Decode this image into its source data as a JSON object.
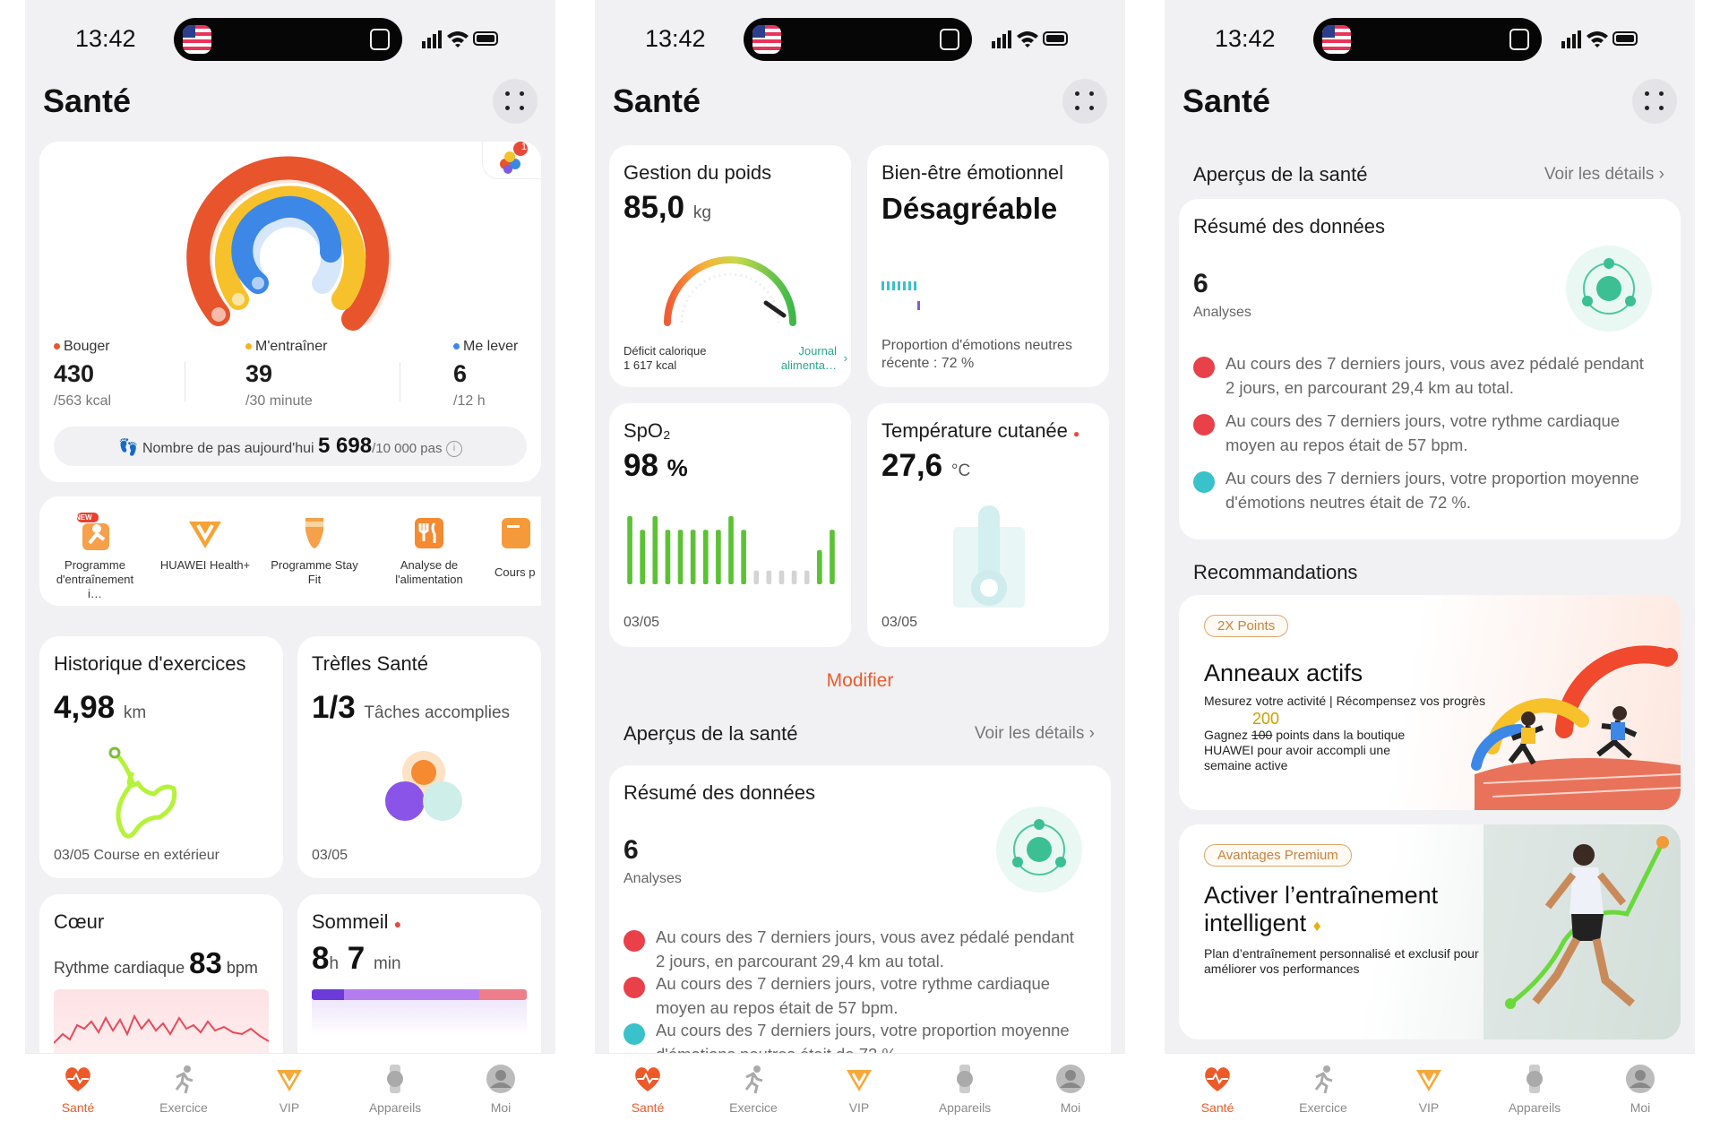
{
  "status": {
    "time": "13:42"
  },
  "app": {
    "title": "Santé"
  },
  "rings": {
    "move": {
      "label": "Bouger",
      "value": "430",
      "target": "/563 kcal",
      "color": "#e8412c"
    },
    "exercise": {
      "label": "M'entraîner",
      "value": "39",
      "target": "/30 minute",
      "color": "#f5b31c"
    },
    "stand": {
      "label": "Me lever",
      "value": "6",
      "target": "/12 h",
      "color": "#3a86e8"
    },
    "steps_label": "Nombre de pas aujourd'hui",
    "steps_value": "5 698",
    "steps_target": "/10 000 pas",
    "badge": "1"
  },
  "shortcuts": [
    {
      "label": "Programme d'entraînement i…",
      "icon": "training-plan-icon",
      "badge": "NEW"
    },
    {
      "label": "HUAWEI Health+",
      "icon": "health-plus-icon"
    },
    {
      "label": "Programme Stay Fit",
      "icon": "stay-fit-icon"
    },
    {
      "label": "Analyse de l'alimentation",
      "icon": "food-analysis-icon"
    },
    {
      "label": "Cours p",
      "icon": "courses-icon"
    }
  ],
  "exercise_history": {
    "title": "Historique d'exercices",
    "value": "4,98",
    "unit": "km",
    "date": "03/05 Course en extérieur"
  },
  "clovers": {
    "title": "Trèfles Santé",
    "value": "1/3",
    "unit": "Tâches accomplies",
    "date": "03/05"
  },
  "heart": {
    "title": "Cœur",
    "label": "Rythme cardiaque",
    "value": "83",
    "unit": "bpm"
  },
  "sleep": {
    "title": "Sommeil",
    "hours": "8",
    "h_unit": "h",
    "minutes": "7",
    "m_unit": "min"
  },
  "weight": {
    "title": "Gestion du poids",
    "value": "85,0",
    "unit": "kg",
    "deficit_label": "Déficit calorique",
    "deficit_value": "1 617 kcal",
    "journal": "Journal alimenta…"
  },
  "emotion": {
    "title": "Bien-être émotionnel",
    "value": "Désagréable",
    "caption": "Proportion d'émotions neutres récente : 72 %"
  },
  "spo2": {
    "title": "SpO₂",
    "value": "98",
    "unit": "%",
    "date": "03/05",
    "bars": [
      1,
      0.8,
      1,
      0.8,
      0.8,
      0.8,
      0.8,
      0.8,
      1,
      0.8,
      0.2,
      0.2,
      0.2,
      0.2,
      0.2,
      0.5,
      0.8
    ]
  },
  "skin_temp": {
    "title": "Température cutanée",
    "value": "27,6",
    "unit": "°C",
    "date": "03/05"
  },
  "modify": "Modifier",
  "overview": {
    "title": "Aperçus de la santé",
    "details": "Voir les détails"
  },
  "summary": {
    "title": "Résumé des données",
    "count": "6",
    "count_label": "Analyses",
    "items": [
      {
        "icon": "bike-icon",
        "color": "#e8414a",
        "text": "Au cours des 7 derniers jours, vous avez pédalé pendant 2 jours, en parcourant 29,4 km au total."
      },
      {
        "icon": "heart-icon",
        "color": "#e8414a",
        "text": "Au cours des 7 derniers jours, votre rythme cardiaque moyen au repos était de 57 bpm."
      },
      {
        "icon": "emotion-icon",
        "color": "#39c2c9",
        "text": "Au cours des 7 derniers jours, votre proportion moyenne d'émotions neutres était de 72 %."
      }
    ]
  },
  "recommendations": {
    "title": "Recommandations",
    "promo1": {
      "pill": "2X Points",
      "title": "Anneaux actifs",
      "subtitle": "Mesurez votre activité | Récompensez vos progrès",
      "new_points": "200",
      "old_points": "100",
      "text_before": "Gagnez",
      "text_after": "points dans la boutique HUAWEI pour avoir accompli une semaine active"
    },
    "promo2": {
      "pill": "Avantages Premium",
      "title": "Activer l’entraînement intelligent",
      "subtitle": "Plan d’entraînement personnalisé et exclusif pour améliorer vos performances"
    }
  },
  "tabs": [
    {
      "label": "Santé",
      "icon": "heart-pulse-icon",
      "active": true
    },
    {
      "label": "Exercice",
      "icon": "running-icon"
    },
    {
      "label": "VIP",
      "icon": "vip-icon"
    },
    {
      "label": "Appareils",
      "icon": "watch-icon"
    },
    {
      "label": "Moi",
      "icon": "profile-icon"
    }
  ],
  "colors": {
    "accent": "#ed5a2a",
    "green": "#5bc235",
    "card": "#ffffff",
    "bg": "#f1f1f3"
  }
}
